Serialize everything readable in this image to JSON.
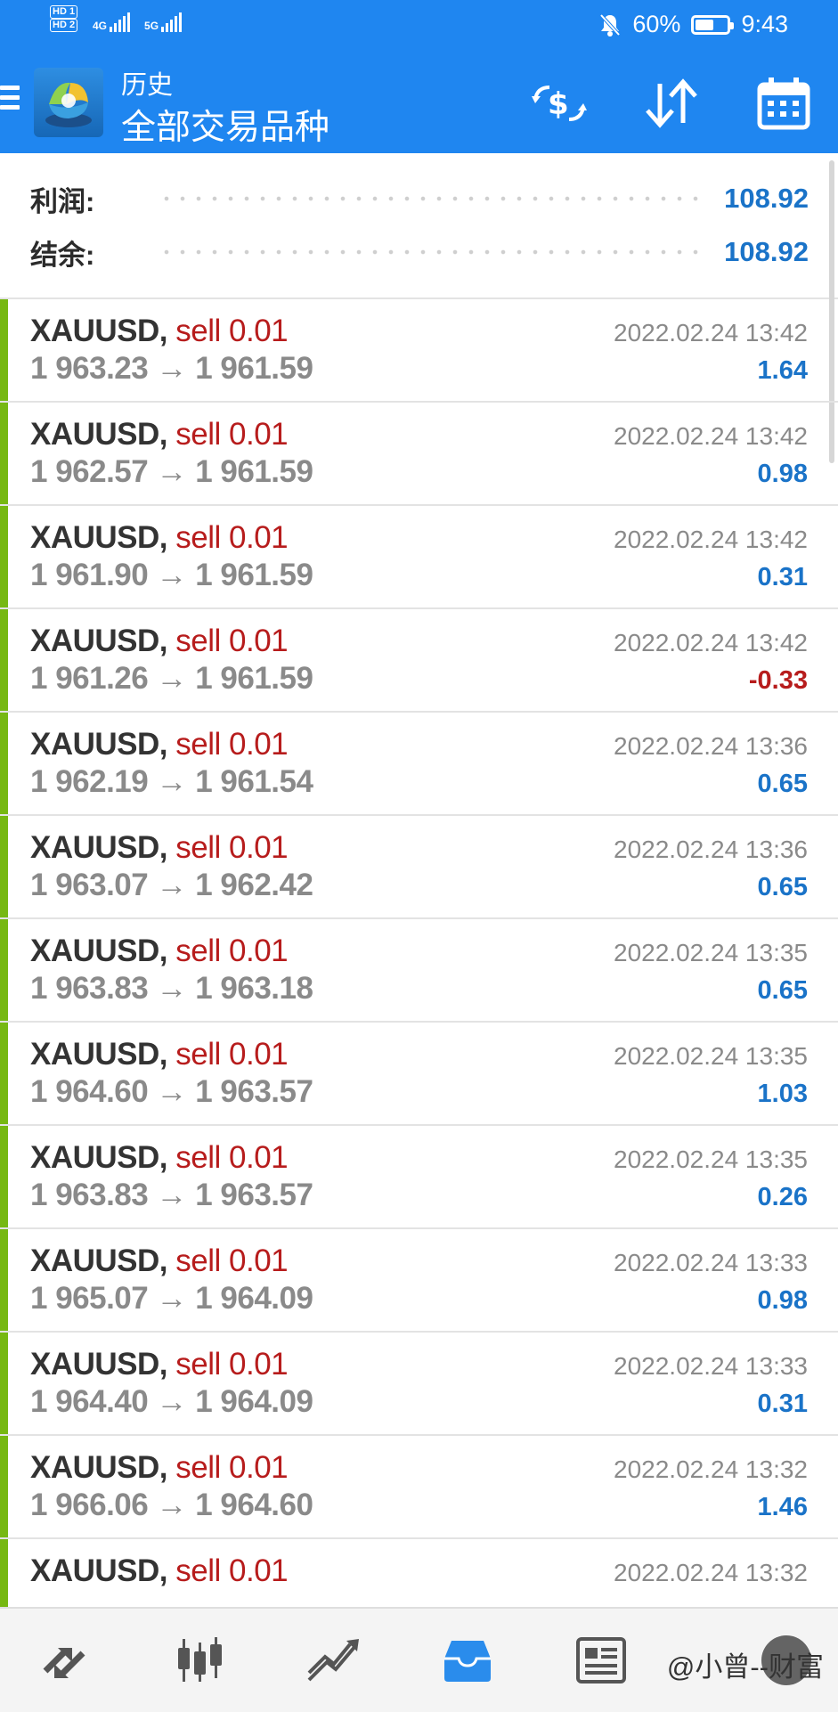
{
  "status_bar": {
    "sim1": "HD 1",
    "sim2": "HD 2",
    "net1": "4G",
    "net2": "5G",
    "battery": "60%",
    "battery_level": 0.6,
    "time": "9:43"
  },
  "header": {
    "title": "历史",
    "subtitle": "全部交易品种",
    "icons": [
      "menu-icon",
      "metatrader-logo",
      "currency-exchange-icon",
      "sort-icon",
      "calendar-icon"
    ]
  },
  "summary": {
    "profit_label": "利润:",
    "profit_value": "108.92",
    "balance_label": "结余:",
    "balance_value": "108.92"
  },
  "deals": [
    {
      "symbol": "XAUUSD,",
      "side": "sell 0.01",
      "open": "1 963.23",
      "close": "1 961.59",
      "time": "2022.02.24 13:42",
      "profit": "1.64",
      "negative": false
    },
    {
      "symbol": "XAUUSD,",
      "side": "sell 0.01",
      "open": "1 962.57",
      "close": "1 961.59",
      "time": "2022.02.24 13:42",
      "profit": "0.98",
      "negative": false
    },
    {
      "symbol": "XAUUSD,",
      "side": "sell 0.01",
      "open": "1 961.90",
      "close": "1 961.59",
      "time": "2022.02.24 13:42",
      "profit": "0.31",
      "negative": false
    },
    {
      "symbol": "XAUUSD,",
      "side": "sell 0.01",
      "open": "1 961.26",
      "close": "1 961.59",
      "time": "2022.02.24 13:42",
      "profit": "-0.33",
      "negative": true
    },
    {
      "symbol": "XAUUSD,",
      "side": "sell 0.01",
      "open": "1 962.19",
      "close": "1 961.54",
      "time": "2022.02.24 13:36",
      "profit": "0.65",
      "negative": false
    },
    {
      "symbol": "XAUUSD,",
      "side": "sell 0.01",
      "open": "1 963.07",
      "close": "1 962.42",
      "time": "2022.02.24 13:36",
      "profit": "0.65",
      "negative": false
    },
    {
      "symbol": "XAUUSD,",
      "side": "sell 0.01",
      "open": "1 963.83",
      "close": "1 963.18",
      "time": "2022.02.24 13:35",
      "profit": "0.65",
      "negative": false
    },
    {
      "symbol": "XAUUSD,",
      "side": "sell 0.01",
      "open": "1 964.60",
      "close": "1 963.57",
      "time": "2022.02.24 13:35",
      "profit": "1.03",
      "negative": false
    },
    {
      "symbol": "XAUUSD,",
      "side": "sell 0.01",
      "open": "1 963.83",
      "close": "1 963.57",
      "time": "2022.02.24 13:35",
      "profit": "0.26",
      "negative": false
    },
    {
      "symbol": "XAUUSD,",
      "side": "sell 0.01",
      "open": "1 965.07",
      "close": "1 964.09",
      "time": "2022.02.24 13:33",
      "profit": "0.98",
      "negative": false
    },
    {
      "symbol": "XAUUSD,",
      "side": "sell 0.01",
      "open": "1 964.40",
      "close": "1 964.09",
      "time": "2022.02.24 13:33",
      "profit": "0.31",
      "negative": false
    },
    {
      "symbol": "XAUUSD,",
      "side": "sell 0.01",
      "open": "1 966.06",
      "close": "1 964.60",
      "time": "2022.02.24 13:32",
      "profit": "1.46",
      "negative": false
    },
    {
      "symbol": "XAUUSD,",
      "side": "sell 0.01",
      "open": "",
      "close": "",
      "time": "2022.02.24 13:32",
      "profit": "",
      "negative": false
    }
  ],
  "bottom_nav": {
    "items": [
      "quotes-icon",
      "chart-candles-icon",
      "trade-icon",
      "history-icon",
      "news-icon"
    ],
    "active": "history-icon"
  },
  "watermark": {
    "text": "@小曾--财富"
  },
  "colors": {
    "header_bg": "#1f86f0",
    "accent_bar": "#76b812",
    "profit_blue": "#1a73c8",
    "sell_red": "#b71c1c"
  }
}
